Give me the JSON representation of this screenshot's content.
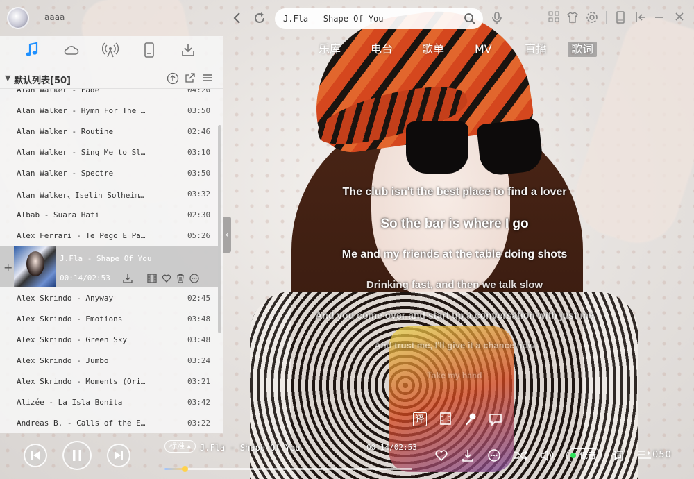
{
  "user": {
    "name": "aaaa"
  },
  "search": {
    "value": "J.Fla - Shape Of You"
  },
  "category_tabs": [
    "乐库",
    "电台",
    "歌单",
    "MV",
    "直播",
    "歌词"
  ],
  "panel_tabs": [
    "music-note-icon",
    "cloud-icon",
    "radio-icon",
    "device-icon",
    "download-icon"
  ],
  "playlist": {
    "title": "默认列表[50]",
    "songs": [
      {
        "name": "Alan Walker - Fade",
        "duration": "04:20"
      },
      {
        "name": "Alan Walker - Hymn For The …",
        "duration": "03:50"
      },
      {
        "name": "Alan Walker - Routine",
        "duration": "02:46"
      },
      {
        "name": "Alan Walker - Sing Me to Sl…",
        "duration": "03:10"
      },
      {
        "name": "Alan Walker - Spectre",
        "duration": "03:50"
      },
      {
        "name": "Alan Walker、Iselin Solheim…",
        "duration": "03:32"
      },
      {
        "name": "Albab - Suara Hati",
        "duration": "02:30"
      },
      {
        "name": "Alex Ferrari - Te Pego E Pa…",
        "duration": "05:26"
      }
    ],
    "now_playing": {
      "name": "J.Fla - Shape Of You",
      "time": "00:14/02:53"
    },
    "songs_after": [
      {
        "name": "Alex Skrindo - Anyway",
        "duration": "02:45"
      },
      {
        "name": "Alex Skrindo - Emotions",
        "duration": "03:48"
      },
      {
        "name": "Alex Skrindo - Green Sky",
        "duration": "03:48"
      },
      {
        "name": "Alex Skrindo - Jumbo",
        "duration": "03:24"
      },
      {
        "name": "Alex Skrindo - Moments (Ori…",
        "duration": "03:21"
      },
      {
        "name": "Alizée - La Isla Bonita",
        "duration": "03:42"
      },
      {
        "name": "Andreas B. - Calls of the E…",
        "duration": "03:22"
      }
    ]
  },
  "lyrics": [
    "The club isn't the best place to find a lover",
    "So the bar is where I go",
    "Me and my friends at the table doing shots",
    "Drinking fast, and then we talk slow",
    "And you come over and start up a conversation with just me",
    "And trust me, I'll give it a chance now",
    "Take my hand"
  ],
  "lyric_tools": {
    "translate_label": "译"
  },
  "player": {
    "quality": "标准",
    "title": "J.Fla - Shape Of You",
    "time": "00:14/02:53",
    "progress": 0.0809,
    "sound_effect": "低音",
    "lyrics_button": "词",
    "playlist_count": "050"
  }
}
